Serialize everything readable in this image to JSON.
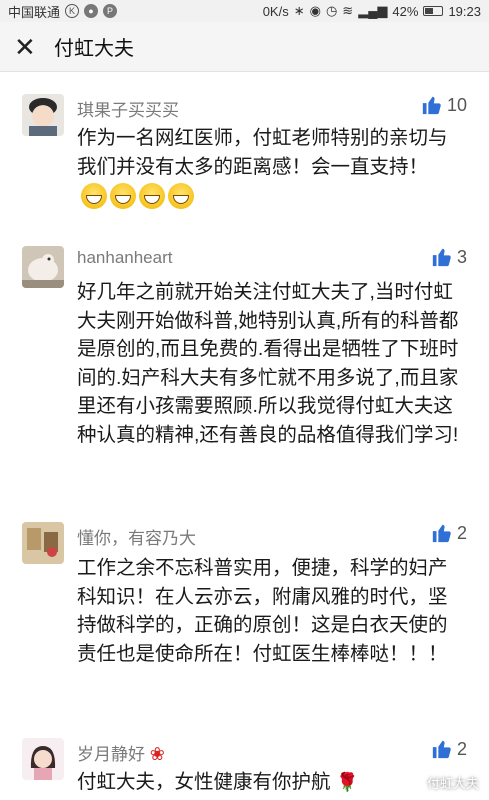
{
  "status_bar": {
    "carrier": "中国联通",
    "speed": "0K/s",
    "battery": "42%",
    "time": "19:23"
  },
  "header": {
    "back_icon": "close-icon",
    "title": "付虹大夫"
  },
  "comments": [
    {
      "user": "琪果子买买买",
      "likes": "10",
      "text": "作为一名网红医师，付虹老师特别的亲切与我们并没有太多的距离感！会一直支持！"
    },
    {
      "user": "hanhanheart",
      "likes": "3",
      "text": "好几年之前就开始关注付虹大夫了,当时付虹大夫刚开始做科普,她特别认真,所有的科普都是原创的,而且免费的.看得出是牺牲了下班时间的.妇产科大夫有多忙就不用多说了,而且家里还有小孩需要照顾.所以我觉得付虹大夫这种认真的精神,还有善良的品格值得我们学习!"
    },
    {
      "user": "懂你，有容乃大",
      "likes": "2",
      "text": "工作之余不忘科普实用，便捷，科学的妇产科知识！在人云亦云，附庸风雅的时代，坚持做科学的，正确的原创！这是白衣天使的责任也是使命所在！付虹医生棒棒哒！！！"
    },
    {
      "user": "岁月静好",
      "likes": "2",
      "text": "付虹大夫，女性健康有你护航"
    }
  ],
  "watermark": "付虹大夫",
  "colors": {
    "like_icon": "#2f6fd6",
    "username": "#7a7a7a"
  }
}
